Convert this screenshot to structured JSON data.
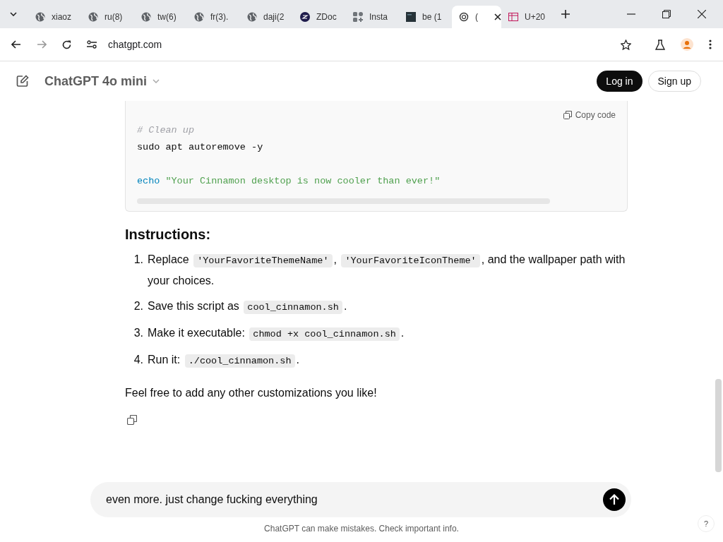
{
  "browser": {
    "tabs": [
      {
        "label": "xiaoz",
        "kind": "globe",
        "selected": false
      },
      {
        "label": "ru(8)",
        "kind": "globe",
        "selected": false
      },
      {
        "label": "tw(6)",
        "kind": "globe",
        "selected": false
      },
      {
        "label": "fr(3).",
        "kind": "globe",
        "selected": false
      },
      {
        "label": "daji(2",
        "kind": "globe",
        "selected": false
      },
      {
        "label": "ZDoc",
        "kind": "zdoc",
        "selected": false
      },
      {
        "label": "Insta",
        "kind": "apps",
        "selected": false
      },
      {
        "label": "be (1",
        "kind": "dark",
        "selected": false
      },
      {
        "label": "(",
        "kind": "chatgpt",
        "selected": true
      },
      {
        "label": "U+20",
        "kind": "table",
        "selected": false
      }
    ],
    "address": "chatgpt.com"
  },
  "app": {
    "model": "ChatGPT 4o mini",
    "login": "Log in",
    "signup": "Sign up"
  },
  "code_block": {
    "copy": "Copy code",
    "lines": [
      {
        "kind": "comment",
        "text": "# Clean up"
      },
      {
        "kind": "plain",
        "text": "sudo apt autoremove -y"
      },
      {
        "kind": "blank"
      },
      {
        "kind": "echo",
        "command": "echo",
        "text": "\"Your Cinnamon desktop is now cooler than ever!\""
      }
    ]
  },
  "heading": "Instructions:",
  "steps": [
    {
      "number": "1.",
      "parts": [
        {
          "kind": "text",
          "text": "Replace "
        },
        {
          "kind": "code",
          "text": "'YourFavoriteThemeName'"
        },
        {
          "kind": "text",
          "text": ", "
        },
        {
          "kind": "code",
          "text": "'YourFavoriteIconTheme'"
        },
        {
          "kind": "text",
          "text": ", and the wallpaper path with your choices."
        }
      ]
    },
    {
      "number": "2.",
      "parts": [
        {
          "kind": "text",
          "text": "Save this script as "
        },
        {
          "kind": "code",
          "text": "cool_cinnamon.sh"
        },
        {
          "kind": "text",
          "text": "."
        }
      ]
    },
    {
      "number": "3.",
      "parts": [
        {
          "kind": "text",
          "text": "Make it executable: "
        },
        {
          "kind": "code",
          "text": "chmod +x cool_cinnamon.sh"
        },
        {
          "kind": "text",
          "text": "."
        }
      ]
    },
    {
      "number": "4.",
      "parts": [
        {
          "kind": "text",
          "text": "Run it: "
        },
        {
          "kind": "code",
          "text": "./cool_cinnamon.sh"
        },
        {
          "kind": "text",
          "text": "."
        }
      ]
    }
  ],
  "closing": "Feel free to add any other customizations you like!",
  "composer": {
    "value": "even more. just change fucking everything"
  },
  "disclaimer": "ChatGPT can make mistakes. Check important info.",
  "help": "?"
}
